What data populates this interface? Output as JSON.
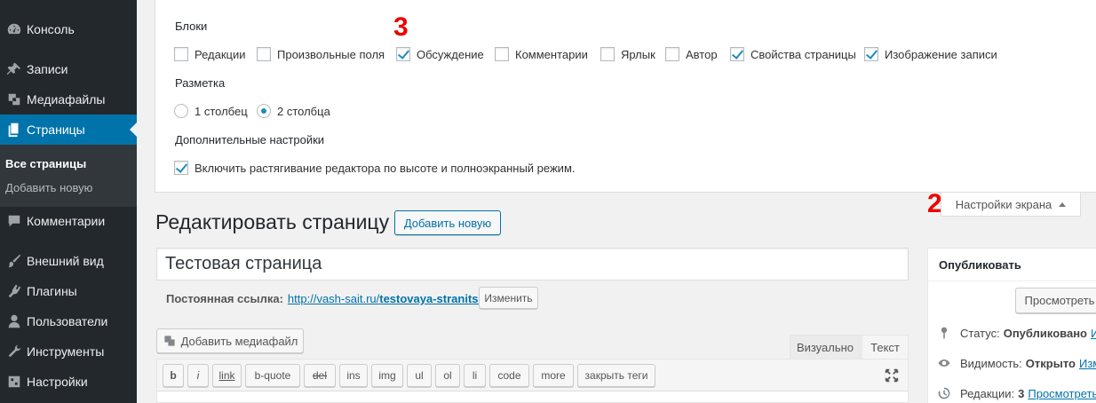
{
  "sidebar": {
    "items": [
      {
        "label": "Консоль",
        "icon": "dashboard-icon"
      },
      {
        "label": "Записи",
        "icon": "pin-icon"
      },
      {
        "label": "Медиафайлы",
        "icon": "media-icon"
      },
      {
        "label": "Страницы",
        "icon": "pages-icon"
      },
      {
        "label": "Комментарии",
        "icon": "comments-icon"
      },
      {
        "label": "Внешний вид",
        "icon": "brush-icon"
      },
      {
        "label": "Плагины",
        "icon": "plugin-icon"
      },
      {
        "label": "Пользователи",
        "icon": "users-icon"
      },
      {
        "label": "Инструменты",
        "icon": "tools-icon"
      },
      {
        "label": "Настройки",
        "icon": "settings-icon"
      }
    ],
    "sub": {
      "all_pages": "Все страницы",
      "add_new": "Добавить новую"
    }
  },
  "screen_options": {
    "boxes_title": "Блоки",
    "boxes": [
      {
        "label": "Редакции",
        "checked": false
      },
      {
        "label": "Произвольные поля",
        "checked": false
      },
      {
        "label": "Обсуждение",
        "checked": true
      },
      {
        "label": "Комментарии",
        "checked": false
      },
      {
        "label": "Ярлык",
        "checked": false
      },
      {
        "label": "Автор",
        "checked": false
      },
      {
        "label": "Свойства страницы",
        "checked": true
      },
      {
        "label": "Изображение записи",
        "checked": true
      }
    ],
    "layout_title": "Разметка",
    "layout_options": [
      {
        "label": "1 столбец",
        "checked": false
      },
      {
        "label": "2 столбца",
        "checked": true
      }
    ],
    "extra_title": "Дополнительные настройки",
    "extra_option": "Включить растягивание редактора по высоте и полноэкранный режим.",
    "tab_label": "Настройки экрана",
    "annotation_3": "3",
    "annotation_2": "2"
  },
  "editor": {
    "heading": "Редактировать страницу",
    "add_new": "Добавить новую",
    "title_value": "Тестовая страница",
    "permalink_label": "Постоянная ссылка:",
    "permalink_base": "http://vash-sait.ru/",
    "permalink_slug": "testovaya-stranitsa",
    "permalink_end": "/",
    "edit_button": "Изменить",
    "add_media": "Добавить медиафайл",
    "tab_visual": "Визуально",
    "tab_text": "Текст",
    "quicktags": [
      "b",
      "i",
      "link",
      "b-quote",
      "del",
      "ins",
      "img",
      "ul",
      "ol",
      "li",
      "code",
      "more",
      "закрыть теги"
    ]
  },
  "publish": {
    "title": "Опубликовать",
    "preview": "Просмотреть",
    "status_label": "Статус:",
    "status_value": "Опубликовано",
    "status_link": "Из",
    "visibility_label": "Видимость:",
    "visibility_value": "Открыто",
    "visibility_link": "Изме",
    "revisions_label": "Редакции:",
    "revisions_value": "3",
    "revisions_link": "Просмотреть"
  }
}
